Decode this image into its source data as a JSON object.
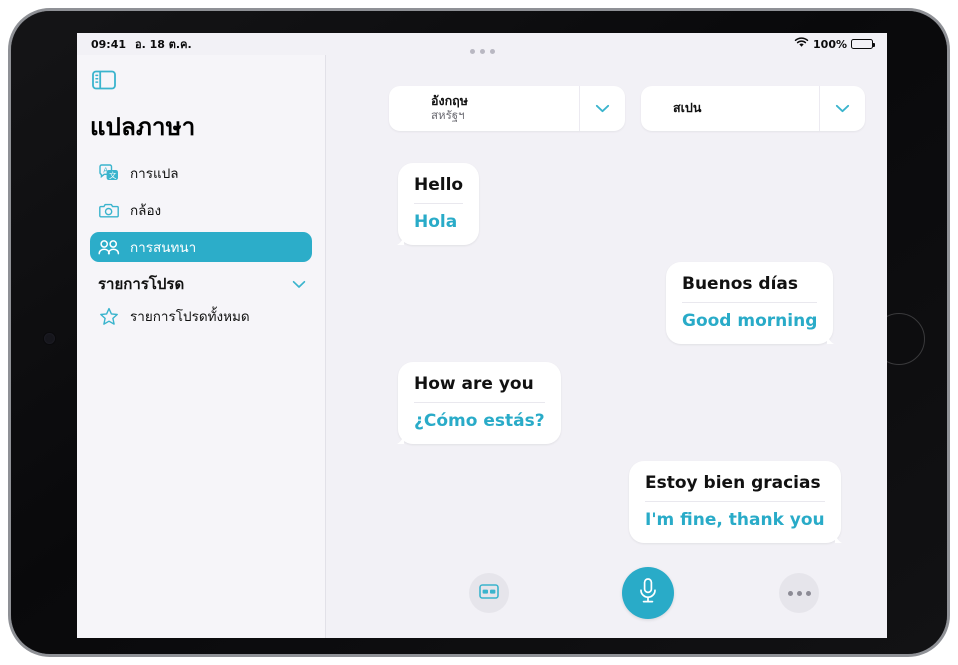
{
  "status_bar": {
    "time": "09:41",
    "date": "อ. 18 ต.ค.",
    "battery_percent": "100%",
    "wifi_icon": "wifi-icon",
    "battery_icon": "battery-full-icon"
  },
  "sidebar": {
    "toggle_icon": "sidebar-toggle-icon",
    "title": "แปลภาษา",
    "items": [
      {
        "label": "การแปล",
        "icon": "translate-icon",
        "selected": false
      },
      {
        "label": "กล้อง",
        "icon": "camera-icon",
        "selected": false
      },
      {
        "label": "การสนทนา",
        "icon": "conversation-people-icon",
        "selected": true
      }
    ],
    "section": {
      "title": "รายการโปรด",
      "chevron_icon": "chevron-down-icon",
      "items": [
        {
          "label": "รายการโปรดทั้งหมด",
          "icon": "star-icon"
        }
      ]
    }
  },
  "language_bar": {
    "source": {
      "primary": "อังกฤษ",
      "secondary": "สหรัฐฯ",
      "chevron_icon": "chevron-down-icon"
    },
    "target": {
      "primary": "สเปน",
      "secondary": "",
      "chevron_icon": "chevron-down-icon"
    }
  },
  "conversation": {
    "messages": [
      {
        "source_text": "Hello",
        "translated_text": "Hola",
        "side": "left"
      },
      {
        "source_text": "Buenos días",
        "translated_text": "Good morning",
        "side": "right"
      },
      {
        "source_text": "How are you",
        "translated_text": "¿Cómo estás?",
        "side": "left"
      },
      {
        "source_text": "Estoy bien gracias",
        "translated_text": "I'm fine, thank you",
        "side": "right"
      }
    ]
  },
  "toolbar": {
    "keyboard_icon": "split-view-icon",
    "mic_icon": "microphone-icon",
    "more_icon": "more-dots-icon"
  },
  "multitask_handle_icon": "multitask-dots-icon",
  "colors": {
    "accent": "#29abc8",
    "sidebar_selected": "#2cadc9",
    "background": "#f2f1f6",
    "bubble": "#ffffff"
  }
}
